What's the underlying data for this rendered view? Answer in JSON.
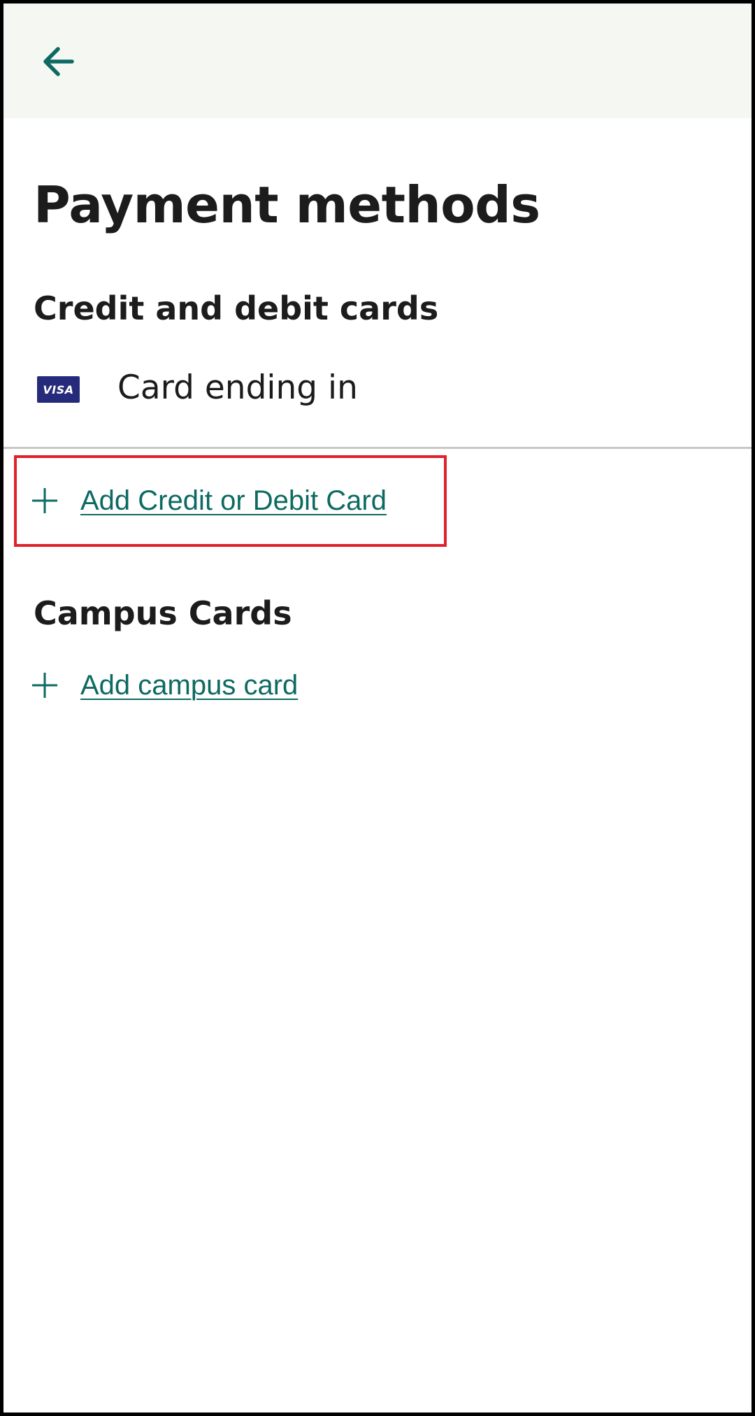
{
  "header": {
    "back_icon": "arrow-left-icon"
  },
  "page": {
    "title": "Payment methods"
  },
  "credit_section": {
    "heading": "Credit and debit cards",
    "cards": [
      {
        "brand": "VISA",
        "label": "Card ending in"
      }
    ],
    "add_label": "Add Credit or Debit Card",
    "add_icon": "plus-icon"
  },
  "campus_section": {
    "heading": "Campus Cards",
    "add_label": "Add campus card",
    "add_icon": "plus-icon"
  },
  "colors": {
    "accent": "#0d6a62",
    "header_bg": "#f5f8f2",
    "text": "#1c1c1c",
    "visa_blue": "#262a7a",
    "highlight": "#e0202a"
  }
}
